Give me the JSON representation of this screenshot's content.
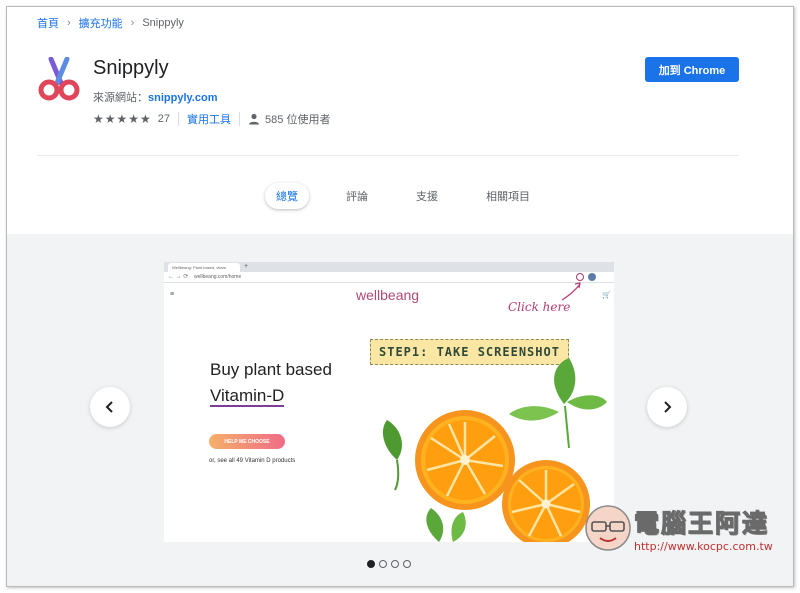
{
  "breadcrumb": {
    "home": "首頁",
    "extensions": "擴充功能",
    "current": "Snippyly"
  },
  "extension": {
    "name": "Snippyly",
    "source_label": "來源網站：",
    "source_link": "snippyly.com",
    "rating_count": "27",
    "category": "實用工具",
    "users": "585 位使用者",
    "stars": "★★★★★"
  },
  "add_button": "加到 Chrome",
  "tabs": [
    {
      "label": "總覽",
      "active": true
    },
    {
      "label": "評論",
      "active": false
    },
    {
      "label": "支援",
      "active": false
    },
    {
      "label": "相關項目",
      "active": false
    }
  ],
  "screenshot": {
    "tab_title": "Wellbeang: Plant based, vitam",
    "tab_plus": "+",
    "nav_glyphs": "← → ⟳",
    "url": "wellbeang.com/home",
    "menu_glyph": "≡",
    "cart_glyph": "🛒",
    "brand": "wellbeang",
    "click_note": "Click here",
    "step_label": "STEP1: TAKE SCREENSHOT",
    "headline_line1": "Buy plant based",
    "headline_line2": "Vitamin-D",
    "cta": "HELP ME CHOOSE",
    "see_all": "or, see all 49 Vitamin D products"
  },
  "carousel": {
    "slides": 4,
    "active_index": 0,
    "prev_glyph": "‹",
    "next_glyph": "›"
  },
  "watermark": {
    "text": "電腦王阿達",
    "url": "http://www.kocpc.com.tw"
  },
  "colors": {
    "accent": "#1a73e8",
    "gallery_bg": "#f1f3f4",
    "brand_pink": "#b04a74",
    "orange": "#f7941d"
  }
}
